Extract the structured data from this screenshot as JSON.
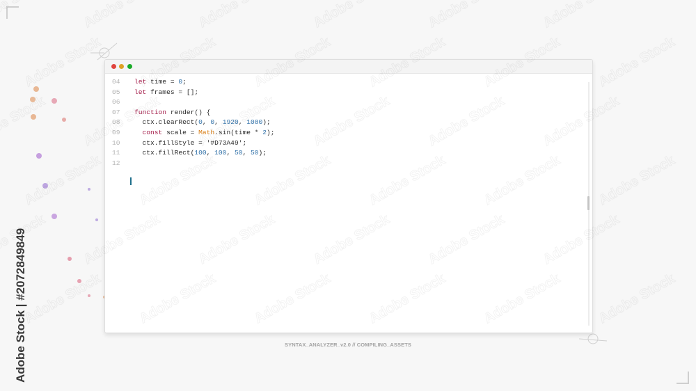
{
  "window": {
    "controls": [
      "close",
      "minimize",
      "maximize"
    ]
  },
  "editor": {
    "lines": [
      {
        "num": "04",
        "tokens": [
          {
            "t": "kw",
            "v": "let"
          },
          {
            "t": "p",
            "v": " time = "
          },
          {
            "t": "num",
            "v": "0"
          },
          {
            "t": "p",
            "v": ";"
          }
        ]
      },
      {
        "num": "05",
        "tokens": [
          {
            "t": "kw",
            "v": "let"
          },
          {
            "t": "p",
            "v": " frames = [];"
          }
        ]
      },
      {
        "num": "06",
        "tokens": []
      },
      {
        "num": "07",
        "tokens": [
          {
            "t": "kw",
            "v": "function"
          },
          {
            "t": "p",
            "v": " render() {"
          }
        ]
      },
      {
        "num": "08",
        "tokens": [
          {
            "t": "p",
            "v": "  ctx.clearRect("
          },
          {
            "t": "num",
            "v": "0"
          },
          {
            "t": "p",
            "v": ", "
          },
          {
            "t": "num",
            "v": "0"
          },
          {
            "t": "p",
            "v": ", "
          },
          {
            "t": "num",
            "v": "1920"
          },
          {
            "t": "p",
            "v": ", "
          },
          {
            "t": "num",
            "v": "1080"
          },
          {
            "t": "p",
            "v": ");"
          }
        ]
      },
      {
        "num": "09",
        "tokens": [
          {
            "t": "p",
            "v": "  "
          },
          {
            "t": "kw",
            "v": "const"
          },
          {
            "t": "p",
            "v": " scale = "
          },
          {
            "t": "cls",
            "v": "Math"
          },
          {
            "t": "p",
            "v": ".sin(time * "
          },
          {
            "t": "num",
            "v": "2"
          },
          {
            "t": "p",
            "v": ");"
          }
        ]
      },
      {
        "num": "10",
        "tokens": [
          {
            "t": "p",
            "v": "  ctx.fillStyle = "
          },
          {
            "t": "str",
            "v": "'#D73A49'"
          },
          {
            "t": "p",
            "v": ";"
          }
        ]
      },
      {
        "num": "11",
        "tokens": [
          {
            "t": "p",
            "v": "  ctx.fillRect("
          },
          {
            "t": "num",
            "v": "100"
          },
          {
            "t": "p",
            "v": ", "
          },
          {
            "t": "num",
            "v": "100"
          },
          {
            "t": "p",
            "v": ", "
          },
          {
            "t": "num",
            "v": "50"
          },
          {
            "t": "p",
            "v": ", "
          },
          {
            "t": "num",
            "v": "50"
          },
          {
            "t": "p",
            "v": ");"
          }
        ]
      },
      {
        "num": "12",
        "tokens": []
      }
    ],
    "colors": {
      "keyword": "#a41d4a",
      "number": "#2e6fa7",
      "class": "#d9801a",
      "plain": "#2b2b2b",
      "line_number": "#b5b5b5",
      "caret": "#1f6f8b"
    }
  },
  "caption": "SYNTAX_ANALYZER_v2.0 // COMPILING_ASSETS",
  "watermark": {
    "vertical_text": "Adobe Stock | #2072849849",
    "repeated_text": "Adobe Stock"
  }
}
